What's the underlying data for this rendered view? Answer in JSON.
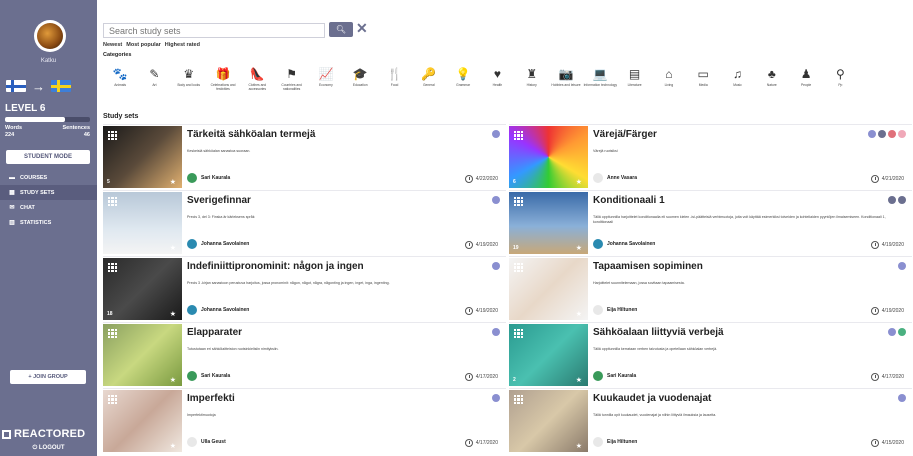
{
  "user": {
    "name": "Katku"
  },
  "flags": {
    "from": "finnish-flag",
    "arrow": "→",
    "to": "swedish-flag"
  },
  "level": {
    "label": "LEVEL 6",
    "progress": 0.7
  },
  "stats": {
    "words_label": "Words",
    "words": "224",
    "sentences_label": "Sentences",
    "sentences": "46"
  },
  "sidebar": {
    "mode_button": "STUDENT MODE",
    "items": [
      {
        "label": "COURSES",
        "icon": "courses-icon",
        "glyph": "▬"
      },
      {
        "label": "STUDY SETS",
        "icon": "study-sets-icon",
        "glyph": "▦"
      },
      {
        "label": "CHAT",
        "icon": "chat-icon",
        "glyph": "✉"
      },
      {
        "label": "STATISTICS",
        "icon": "statistics-icon",
        "glyph": "▥"
      }
    ],
    "join_button": "+ JOIN GROUP",
    "brand": "REACTORED",
    "logout": "⏻ LOGOUT"
  },
  "search": {
    "placeholder": "Search study sets",
    "button_icon": "search-icon",
    "clear_icon": "close-icon"
  },
  "sort": {
    "newest": "Newest",
    "popular": "Most popular",
    "rated": "Highest rated"
  },
  "categories_title": "Categories",
  "categories": [
    {
      "label": "Animals",
      "glyph": "🐾"
    },
    {
      "label": "Art",
      "glyph": "✎"
    },
    {
      "label": "Body and looks",
      "glyph": "♛"
    },
    {
      "label": "Celebrations and festivities",
      "glyph": "🎁"
    },
    {
      "label": "Clothes and accessories",
      "glyph": "👠"
    },
    {
      "label": "Countries and nationalities",
      "glyph": "⚑"
    },
    {
      "label": "Economy",
      "glyph": "📈"
    },
    {
      "label": "Education",
      "glyph": "🎓"
    },
    {
      "label": "Food",
      "glyph": "🍴"
    },
    {
      "label": "General",
      "glyph": "🔑"
    },
    {
      "label": "Grammar",
      "glyph": "💡"
    },
    {
      "label": "Health",
      "glyph": "♥"
    },
    {
      "label": "History",
      "glyph": "♜"
    },
    {
      "label": "Hobbies and leisure",
      "glyph": "📷"
    },
    {
      "label": "Information technology",
      "glyph": "💻"
    },
    {
      "label": "Literature",
      "glyph": "▤"
    },
    {
      "label": "Living",
      "glyph": "⌂"
    },
    {
      "label": "Media",
      "glyph": "▭"
    },
    {
      "label": "Music",
      "glyph": "♫"
    },
    {
      "label": "Nature",
      "glyph": "♣"
    },
    {
      "label": "People",
      "glyph": "♟"
    },
    {
      "label": "Pp",
      "glyph": "⚲"
    }
  ],
  "study_sets_title": "Study sets",
  "sets": [
    {
      "title": "Tärkeitä sähköalan termejä",
      "desc": "Keskeisiä sähköalan sanastoa suoraan.",
      "author": "Sari Kaurala",
      "date": "4/22/2020",
      "likes": "5",
      "badges": [
        "#8a8fd0"
      ],
      "thumb": "linear-gradient(135deg,#1a1a1a,#5a4a3a 50%,#e0b070)",
      "av": "#3a9a5a"
    },
    {
      "title": "Värejä/Färger",
      "desc": "Värejä ruotsiksi",
      "author": "Anne Vasara",
      "date": "4/21/2020",
      "likes": "6",
      "badges": [
        "#8a8fd0",
        "#6b6f8f",
        "#e0707a",
        "#f0a8b8"
      ],
      "thumb": "conic-gradient(#e33,#f93,#fd3,#3c3,#39f,#93f,#e33)",
      "av": "#e8e8e8"
    },
    {
      "title": "Sverigefinnar",
      "desc": "Precis 3, del 3: Finska är kärleksens språk",
      "author": "Johanna Savolainen",
      "date": "4/19/2020",
      "likes": "",
      "badges": [
        "#8a8fd0"
      ],
      "thumb": "linear-gradient(180deg,#b8c8d8,#dfe8f0 60%,#f4f4f4)",
      "av": "#2a8ab0"
    },
    {
      "title": "Konditionaali 1",
      "desc": "Tällä oppitunnilla harjoittelet konditionaalia eli suomen kielen -isi-päätteisiä verbimuotoja, joita voit käyttää esimerkiksi toiveiden ja kohteliaiden pyyntöjen ilmaisemiseen. Konditionaali 1, konditionaali",
      "author": "Johanna Savolainen",
      "date": "4/19/2020",
      "likes": "19",
      "badges": [
        "#6b6f8f",
        "#6b6f8f"
      ],
      "thumb": "linear-gradient(180deg,#3a6aa8,#8ab0d8 55%,#c8a878)",
      "av": "#2a8ab0"
    },
    {
      "title": "Indefiniittipronominit: någon ja ingen",
      "desc": "Precis 3 -kirjan sanastoon perustuva harjoitus, jossa pronominit: någon, något, några, någonting ja ingen, inget, inga, ingenting.",
      "author": "Johanna Savolainen",
      "date": "4/19/2020",
      "likes": "18",
      "badges": [
        "#8a8fd0"
      ],
      "thumb": "linear-gradient(135deg,#2a2a2a,#4a4a4a 50%,#1a1a1a)",
      "av": "#2a8ab0"
    },
    {
      "title": "Tapaamisen sopiminen",
      "desc": "Harjoittelet suunnitelemaan, jossa sovitaan tapaamisesta.",
      "author": "Eija Hiltunen",
      "date": "4/19/2020",
      "likes": "",
      "badges": [
        "#8a8fd0"
      ],
      "thumb": "linear-gradient(135deg,#f4f4f4,#e8d8c8 50%,#f4f4f4)",
      "av": "#e8e8e8"
    },
    {
      "title": "Elapparater",
      "desc": "Tutustutaan eri sähkölaitteiston ruotsinkielisiin nimityksiin.",
      "author": "Sari Kaurala",
      "date": "4/17/2020",
      "likes": "",
      "badges": [
        "#8a8fd0"
      ],
      "thumb": "linear-gradient(135deg,#8aa060,#c8d880 50%,#7a9a40)",
      "av": "#3a9a5a"
    },
    {
      "title": "Sähköalaan liittyviä verbejä",
      "desc": "Tällä oppitunnilla kerrataan verben taivutusta ja opetellaan sähköalan verbejä.",
      "author": "Sari Kaurala",
      "date": "4/17/2020",
      "likes": "2",
      "badges": [
        "#8a8fd0",
        "#4ab080"
      ],
      "thumb": "linear-gradient(135deg,#2a9a90,#4ac0b0 50%,#2a7a70)",
      "av": "#3a9a5a"
    },
    {
      "title": "Imperfekti",
      "desc": "Imperfektimuotoja",
      "author": "Ulla Geust",
      "date": "4/17/2020",
      "likes": "",
      "badges": [
        "#8a8fd0"
      ],
      "thumb": "linear-gradient(135deg,#e8d8d0,#c8a898 50%,#f0e8e0)",
      "av": "#e8e8e8"
    },
    {
      "title": "Kuukaudet ja vuodenajat",
      "desc": "Tällä tunnilla opit kuukaudet, vuodenajat ja niihin liittyviä ilmauksia ja lauseita.",
      "author": "Eija Hiltunen",
      "date": "4/15/2020",
      "likes": "",
      "badges": [
        "#8a8fd0"
      ],
      "thumb": "linear-gradient(135deg,#b0a090,#d8c8a8 50%,#8a7a6a)",
      "av": "#e8e8e8"
    }
  ]
}
